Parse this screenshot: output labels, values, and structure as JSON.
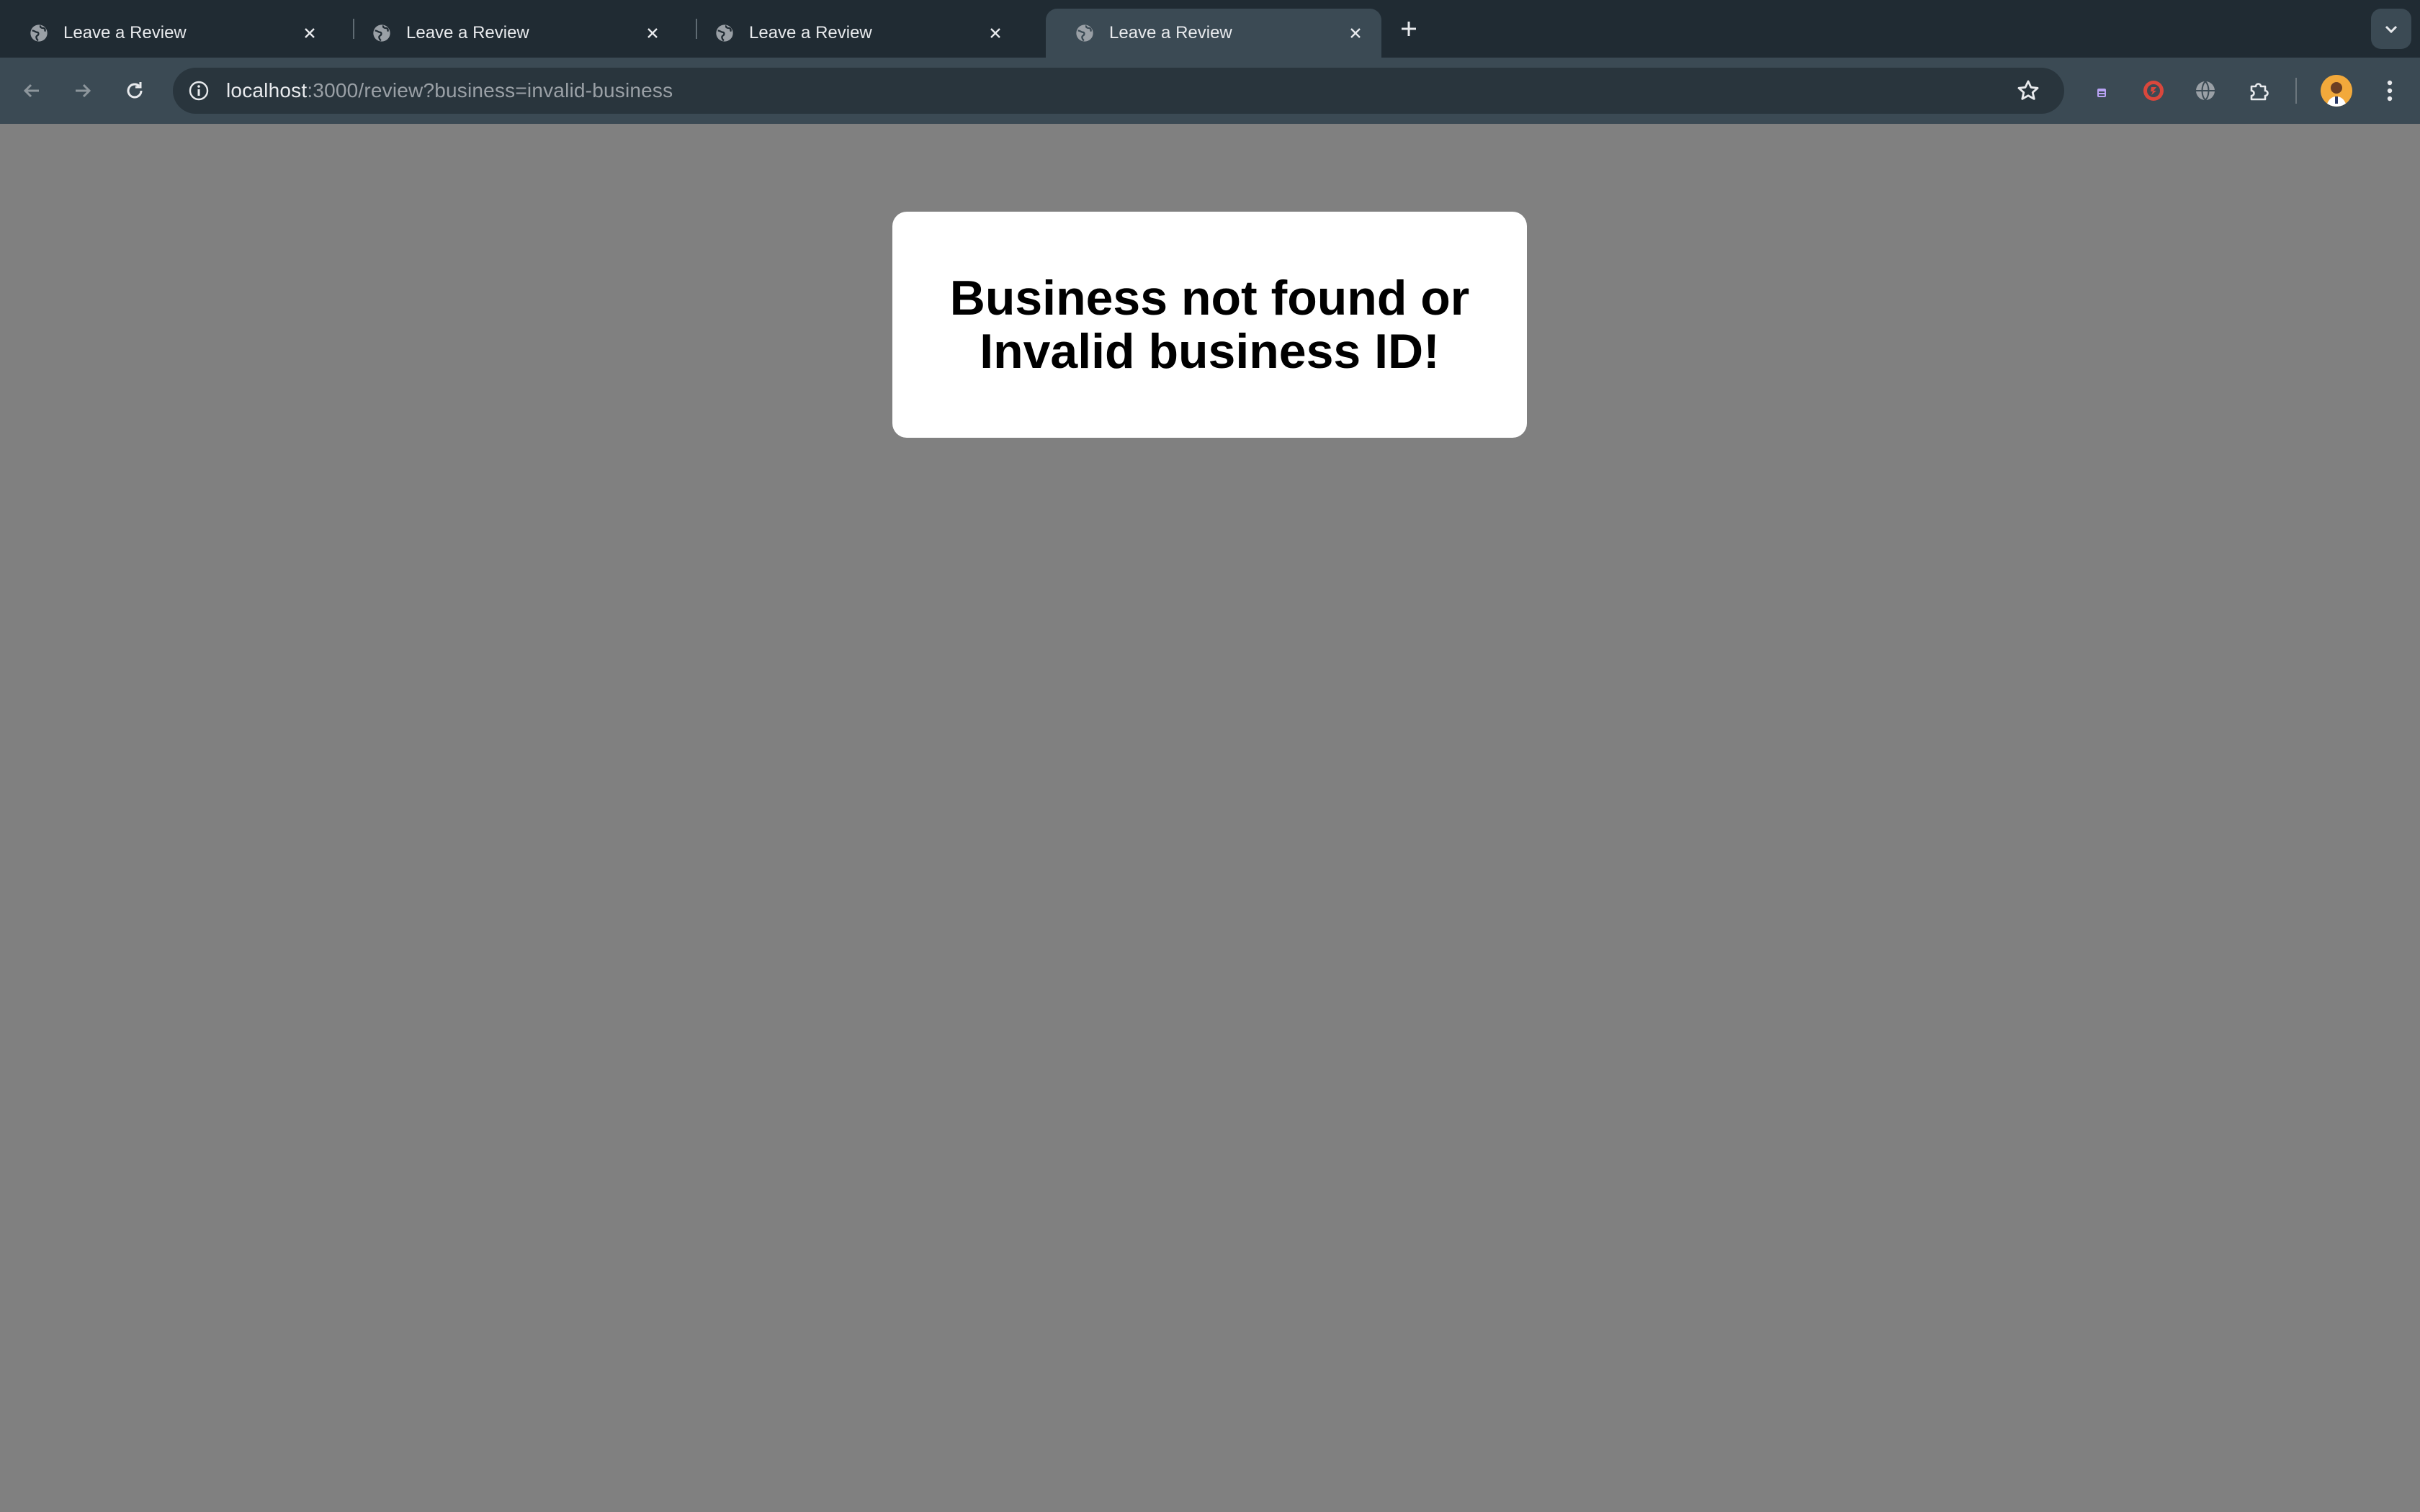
{
  "browser": {
    "tabs": [
      {
        "title": "Leave a Review",
        "favicon": "globe-icon",
        "active": false
      },
      {
        "title": "Leave a Review",
        "favicon": "globe-icon",
        "active": false
      },
      {
        "title": "Leave a Review",
        "favicon": "globe-icon",
        "active": false
      },
      {
        "title": "Leave a Review",
        "favicon": "globe-icon",
        "active": true
      }
    ],
    "address_bar": {
      "host": "localhost",
      "path": ":3000/review?business=invalid-business"
    },
    "extensions": [
      "purple-extension-icon",
      "red-shield-extension-icon",
      "globe-extension-icon",
      "puzzle-icon"
    ]
  },
  "page": {
    "message_line1": "Business not found or",
    "message_line2": "Invalid business ID!"
  },
  "colors": {
    "page_background": "#808080",
    "card_background": "#ffffff",
    "tabstrip_background": "#202b33",
    "toolbar_background": "#3b4a54"
  }
}
